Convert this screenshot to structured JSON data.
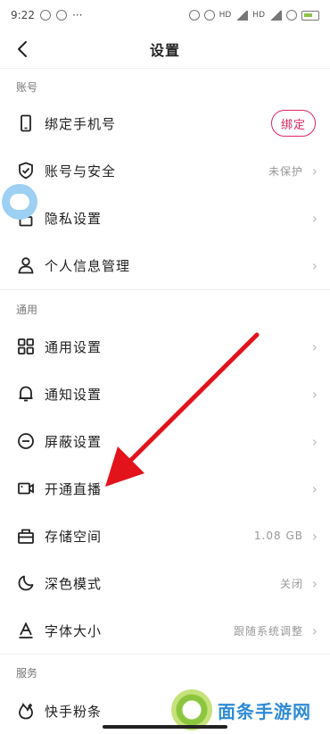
{
  "status_bar": {
    "time": "9:22",
    "dots": "···",
    "battery_level": "80",
    "hd1": "HD",
    "hd2": "HD"
  },
  "header": {
    "back_icon": "chevron-left-icon",
    "title": "设置"
  },
  "sections": {
    "account": "账号",
    "general": "通用",
    "service": "服务"
  },
  "rows": {
    "bind_phone": {
      "label": "绑定手机号",
      "icon": "phone-icon",
      "action": "绑定"
    },
    "account_security": {
      "label": "账号与安全",
      "icon": "shield-check-icon",
      "value": "未保护"
    },
    "privacy": {
      "label": "隐私设置",
      "icon": "lock-icon"
    },
    "personal_info": {
      "label": "个人信息管理",
      "icon": "person-icon"
    },
    "general_settings": {
      "label": "通用设置",
      "icon": "grid-icon"
    },
    "notification": {
      "label": "通知设置",
      "icon": "bell-icon"
    },
    "block": {
      "label": "屏蔽设置",
      "icon": "minus-circle-icon"
    },
    "live": {
      "label": "开通直播",
      "icon": "video-camera-icon"
    },
    "storage": {
      "label": "存储空间",
      "icon": "storage-box-icon",
      "value": "1.08 GB"
    },
    "dark_mode": {
      "label": "深色模式",
      "icon": "moon-icon",
      "value": "关闭"
    },
    "font_size": {
      "label": "字体大小",
      "icon": "font-a-icon",
      "value": "跟随系统调整"
    },
    "kuaishou_fans": {
      "label": "快手粉条",
      "icon": "fans-icon"
    }
  },
  "watermark": {
    "text": "面条手游网"
  },
  "colors": {
    "accent": "#e0245e",
    "arrow": "#e3131b",
    "floating_ball": "#9dd0f2"
  }
}
